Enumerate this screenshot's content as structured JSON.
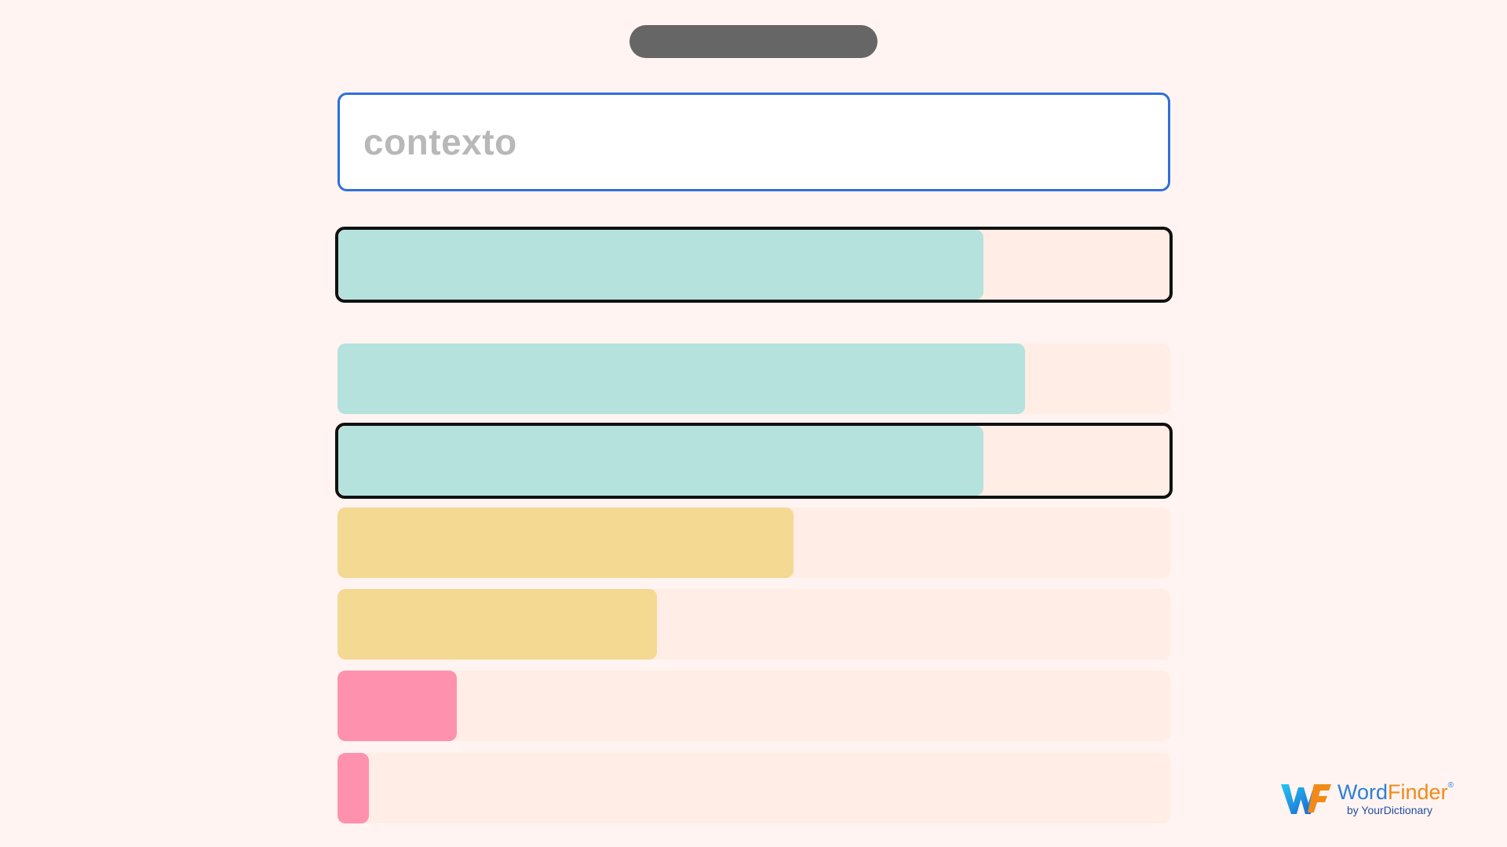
{
  "search": {
    "value": "contexto"
  },
  "guesses": [
    {
      "level": 0.775,
      "color": "#b5e2dd",
      "selected": true
    },
    {
      "level": 0.826,
      "color": "#b5e2dd",
      "selected": false
    },
    {
      "level": 0.775,
      "color": "#b5e2dd",
      "selected": true
    },
    {
      "level": 0.548,
      "color": "#f4d993",
      "selected": false
    },
    {
      "level": 0.384,
      "color": "#f4d993",
      "selected": false
    },
    {
      "level": 0.143,
      "color": "#fe92ae",
      "selected": false
    },
    {
      "level": 0.038,
      "color": "#fe92ae",
      "selected": false
    }
  ],
  "colors": {
    "background": "#fff4f1",
    "track": "#ffede6",
    "focus_border": "#2f6fdc",
    "selected_border": "#111111",
    "green": "#b5e2dd",
    "yellow": "#f4d993",
    "pink": "#fe92ae"
  },
  "logo": {
    "name_part1": "Word",
    "name_part2": "Finder",
    "registered": "®",
    "tagline": "by YourDictionary",
    "icon": "wordfinder-logo-icon"
  }
}
